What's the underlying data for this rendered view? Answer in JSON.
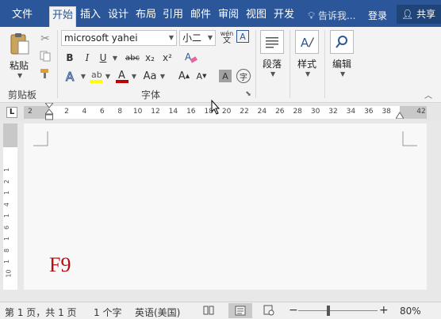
{
  "tabs": [
    {
      "label": "文件",
      "active": false
    },
    {
      "label": "开始",
      "active": true
    },
    {
      "label": "插入",
      "active": false
    },
    {
      "label": "设计",
      "active": false
    },
    {
      "label": "布局",
      "active": false
    },
    {
      "label": "引用",
      "active": false
    },
    {
      "label": "邮件",
      "active": false
    },
    {
      "label": "审阅",
      "active": false
    },
    {
      "label": "视图",
      "active": false
    },
    {
      "label": "开发",
      "active": false
    }
  ],
  "tell_me": "告诉我...",
  "login": "登录",
  "share": "共享",
  "ribbon": {
    "clipboard": {
      "paste_label": "粘贴",
      "group_label": "剪贴板"
    },
    "font": {
      "font_name": "microsoft yahei",
      "font_size": "小二",
      "wen_label": "wén",
      "wen_char": "文",
      "group_label": "字体",
      "bold": "B",
      "italic": "I",
      "underline": "U",
      "strike": "abc",
      "subscript": "x₂",
      "superscript": "x²",
      "change_case": "Aa",
      "grow": "A",
      "shrink": "A",
      "char_border": "A",
      "enclose": "字"
    },
    "paragraph": {
      "label": "段落"
    },
    "styles": {
      "label": "样式"
    },
    "editing": {
      "label": "编辑"
    }
  },
  "ruler": {
    "left_ticks": [
      "2"
    ],
    "ticks": [
      "2",
      "4",
      "6",
      "8",
      "10",
      "12",
      "14",
      "16",
      "18",
      "20",
      "22",
      "24",
      "26",
      "28",
      "30",
      "32",
      "34",
      "36",
      "38"
    ],
    "right_ticks": [
      "42"
    ],
    "tab_marker": "L"
  },
  "vruler_ticks": [
    "1",
    "2",
    "1",
    "4",
    "1",
    "6",
    "1",
    "8",
    "1",
    "10"
  ],
  "document": {
    "text": "F9"
  },
  "status": {
    "page": "第 1 页，共 1 页",
    "words": "1 个字",
    "language": "英语(美国)",
    "zoom": "80%",
    "minus": "−",
    "plus": "+"
  },
  "colors": {
    "brand": "#2b579a",
    "highlight": "#ffff00",
    "font_color": "#c00000",
    "doc_text": "#b01010"
  }
}
